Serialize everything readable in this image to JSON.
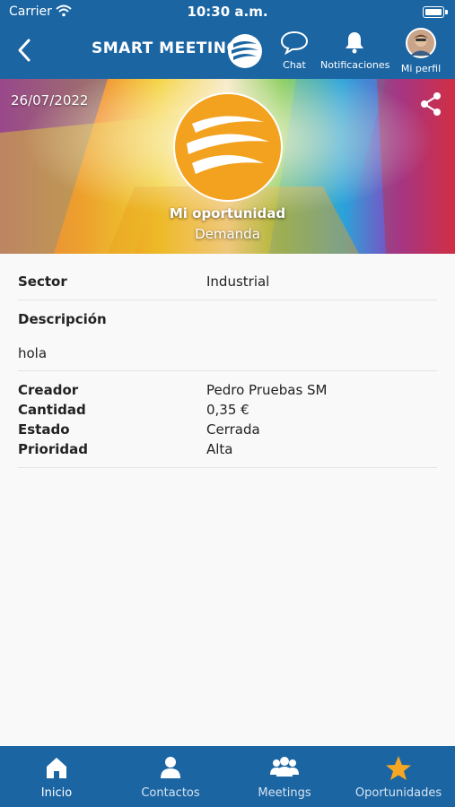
{
  "status": {
    "carrier": "Carrier",
    "time": "10:30 a.m."
  },
  "header": {
    "brand": "SMART MEETING",
    "chat_label": "Chat",
    "notifications_label": "Notificaciones",
    "profile_label": "Mi perfil"
  },
  "hero": {
    "date": "26/07/2022",
    "title": "Mi oportunidad",
    "subtitle": "Demanda"
  },
  "details": {
    "sector_label": "Sector",
    "sector_value": "Industrial",
    "description_label": "Descripción",
    "description_value": "hola",
    "creator_label": "Creador",
    "creator_value": "Pedro Pruebas SM",
    "quantity_label": "Cantidad",
    "quantity_value": "0,35 €",
    "state_label": "Estado",
    "state_value": "Cerrada",
    "priority_label": "Prioridad",
    "priority_value": "Alta"
  },
  "tabs": [
    {
      "label": "Inicio",
      "icon": "home-icon",
      "active": true
    },
    {
      "label": "Contactos",
      "icon": "person-icon",
      "active": false
    },
    {
      "label": "Meetings",
      "icon": "group-icon",
      "active": false
    },
    {
      "label": "Oportunidades",
      "icon": "star-icon",
      "active": false
    }
  ],
  "colors": {
    "primary": "#1b65a3",
    "accent": "#f5a623",
    "logo_orange": "#f3a220"
  }
}
